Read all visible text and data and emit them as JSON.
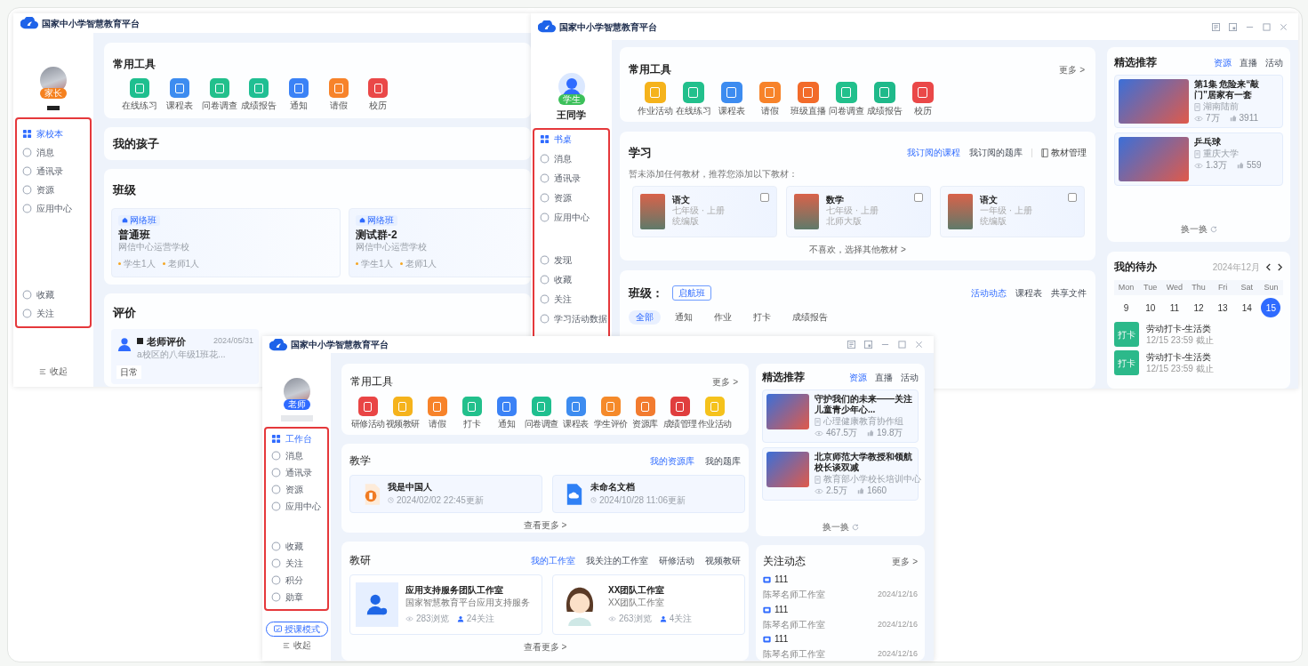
{
  "windows": [
    {
      "kind": "parent",
      "logo_text": "国家中小学智慧教育平台",
      "sidebar": {
        "badge": "家长",
        "nav": [
          {
            "label": "家校本",
            "selected": true
          },
          {
            "label": "消息",
            "selected": false
          },
          {
            "label": "通讯录",
            "selected": false
          },
          {
            "label": "资源",
            "selected": false
          },
          {
            "label": "应用中心",
            "selected": false
          }
        ],
        "nav_bottom": [
          {
            "label": "收藏",
            "selected": false
          },
          {
            "label": "关注",
            "selected": false
          }
        ],
        "collapse": "收起"
      },
      "tools": {
        "title": "常用工具",
        "items": [
          {
            "label": "在线练习",
            "color": "#1fbf8f"
          },
          {
            "label": "课程表",
            "color": "#3d8cf0"
          },
          {
            "label": "问卷调查",
            "color": "#22c08c"
          },
          {
            "label": "成绩报告",
            "color": "#20bf93"
          },
          {
            "label": "通知",
            "color": "#3b82f6"
          },
          {
            "label": "请假",
            "color": "#f7832a"
          },
          {
            "label": "校历",
            "color": "#ea4848"
          }
        ]
      },
      "children": {
        "title": "我的孩子"
      },
      "classes": {
        "title": "班级",
        "cards": [
          {
            "tag": "网络班",
            "name": "普通班",
            "school": "网信中心运营学校",
            "students": "学生1人",
            "teachers": "老师1人"
          },
          {
            "tag": "网络班",
            "name": "测试群-2",
            "school": "网信中心运营学校",
            "students": "学生1人",
            "teachers": "老师1人"
          }
        ]
      },
      "evaluation": {
        "title": "评价",
        "card": {
          "title": "老师评价",
          "desc": "a校区的八年级1班花...",
          "date": "2024/05/31",
          "tag": "日常"
        }
      }
    },
    {
      "kind": "student",
      "logo_text": "国家中小学智慧教育平台",
      "sidebar": {
        "badge": "学生",
        "user_name": "王同学",
        "nav": [
          {
            "label": "书桌",
            "selected": true
          },
          {
            "label": "消息",
            "selected": false
          },
          {
            "label": "通讯录",
            "selected": false
          },
          {
            "label": "资源",
            "selected": false
          },
          {
            "label": "应用中心",
            "selected": false
          }
        ],
        "nav_bottom": [
          {
            "label": "发现",
            "selected": false
          },
          {
            "label": "收藏",
            "selected": false
          },
          {
            "label": "关注",
            "selected": false
          },
          {
            "label": "学习活动数据",
            "selected": false
          }
        ]
      },
      "tools": {
        "title": "常用工具",
        "more": "更多 >",
        "items": [
          {
            "label": "作业活动",
            "color": "#f5b31c"
          },
          {
            "label": "在线练习",
            "color": "#22c08c"
          },
          {
            "label": "课程表",
            "color": "#3d8cf0"
          },
          {
            "label": "请假",
            "color": "#f7832a"
          },
          {
            "label": "班级直播",
            "color": "#f26b2a"
          },
          {
            "label": "问卷调查",
            "color": "#22c08c"
          },
          {
            "label": "成绩报告",
            "color": "#1fb98a"
          },
          {
            "label": "校历",
            "color": "#ea4848"
          }
        ]
      },
      "study": {
        "title": "学习",
        "tabs": [
          {
            "label": "我订阅的课程",
            "selected": true
          },
          {
            "label": "我订阅的题库",
            "selected": false
          }
        ],
        "manage": "教材管理",
        "hint": "暂未添加任何教材，推荐您添加以下教材：",
        "books": [
          {
            "title": "语文",
            "grade": "七年级 · 上册",
            "edition": "统编版",
            "checked": false
          },
          {
            "title": "数学",
            "grade": "七年级 · 上册",
            "edition": "北师大版",
            "checked": false
          },
          {
            "title": "语文",
            "grade": "一年级 · 上册",
            "edition": "统编版",
            "checked": false
          }
        ],
        "more": "不喜欢，选择其他教材 >"
      },
      "class_feed": {
        "title": "班级：",
        "class_tag": "启航班",
        "tabs": [
          {
            "label": "活动动态",
            "selected": true
          },
          {
            "label": "课程表",
            "selected": false
          },
          {
            "label": "共享文件",
            "selected": false
          }
        ],
        "filters": [
          {
            "label": "全部",
            "selected": true
          },
          {
            "label": "通知",
            "selected": false
          },
          {
            "label": "作业",
            "selected": false
          },
          {
            "label": "打卡",
            "selected": false
          },
          {
            "label": "成绩报告",
            "selected": false
          }
        ]
      },
      "featured": {
        "title": "精选推荐",
        "tabs": [
          {
            "label": "资源",
            "selected": true
          },
          {
            "label": "直播",
            "selected": false
          },
          {
            "label": "活动",
            "selected": false
          }
        ],
        "items": [
          {
            "title": "第1集 危险来“敲门”居家有一套",
            "source": "湖南陆前",
            "views": "7万",
            "likes": "3911"
          },
          {
            "title": "乒乓球",
            "source": "重庆大学",
            "views": "1.3万",
            "likes": "559"
          }
        ],
        "refresh": "换一换"
      },
      "todo": {
        "title": "我的待办",
        "month": "2024年12月",
        "weekdays": [
          "Mon",
          "Tue",
          "Wed",
          "Thu",
          "Fri",
          "Sat",
          "Sun"
        ],
        "days": [
          {
            "label": "9",
            "selected": false
          },
          {
            "label": "10",
            "selected": false
          },
          {
            "label": "11",
            "selected": false
          },
          {
            "label": "12",
            "selected": false
          },
          {
            "label": "13",
            "selected": false
          },
          {
            "label": "14",
            "selected": false
          },
          {
            "label": "15",
            "selected": true
          }
        ],
        "items": [
          {
            "tag": "打卡",
            "title": "劳动打卡-生活类",
            "deadline": "12/15 23:59 截止"
          },
          {
            "tag": "打卡",
            "title": "劳动打卡-生活类",
            "deadline": "12/15 23:59 截止"
          }
        ]
      }
    },
    {
      "kind": "teacher",
      "logo_text": "国家中小学智慧教育平台",
      "sidebar": {
        "badge": "老师",
        "nav": [
          {
            "label": "工作台",
            "selected": true
          },
          {
            "label": "消息",
            "selected": false
          },
          {
            "label": "通讯录",
            "selected": false
          },
          {
            "label": "资源",
            "selected": false
          },
          {
            "label": "应用中心",
            "selected": false
          }
        ],
        "nav_bottom": [
          {
            "label": "收藏",
            "selected": false
          },
          {
            "label": "关注",
            "selected": false
          },
          {
            "label": "积分",
            "selected": false
          },
          {
            "label": "勋章",
            "selected": false
          }
        ],
        "mode_button": "授课模式",
        "collapse": "收起"
      },
      "tools": {
        "title": "常用工具",
        "more": "更多 >",
        "items": [
          {
            "label": "研修活动",
            "color": "#e94545"
          },
          {
            "label": "视频教研",
            "color": "#f5b31c"
          },
          {
            "label": "请假",
            "color": "#f7832a"
          },
          {
            "label": "打卡",
            "color": "#22c08c"
          },
          {
            "label": "通知",
            "color": "#3b82f6"
          },
          {
            "label": "问卷调查",
            "color": "#1fbf8f"
          },
          {
            "label": "课程表",
            "color": "#3d8cf0"
          },
          {
            "label": "学生评价",
            "color": "#f58a2a"
          },
          {
            "label": "资源库",
            "color": "#f27b2f"
          },
          {
            "label": "成绩管理",
            "color": "#e03e3e"
          },
          {
            "label": "作业活动",
            "color": "#f5c21c"
          }
        ]
      },
      "teaching": {
        "title": "教学",
        "tabs": [
          {
            "label": "我的资源库",
            "selected": true
          },
          {
            "label": "我的题库",
            "selected": false
          }
        ],
        "files": [
          {
            "kind": "slides",
            "title": "我是中国人",
            "updated": "2024/02/02 22:45更新"
          },
          {
            "kind": "cloud",
            "title": "未命名文档",
            "updated": "2024/10/28 11:06更新"
          }
        ],
        "more": "查看更多 >"
      },
      "research": {
        "title": "教研",
        "tabs": [
          {
            "label": "我的工作室",
            "selected": true
          },
          {
            "label": "我关注的工作室",
            "selected": false
          },
          {
            "label": "研修活动",
            "selected": false
          },
          {
            "label": "视频教研",
            "selected": false
          }
        ],
        "studios": [
          {
            "kind": "person",
            "title": "应用支持服务团队工作室",
            "desc": "国家智慧教育平台应用支持服务",
            "views": "283浏览",
            "follows": "24关注"
          },
          {
            "kind": "cartoon",
            "title": "XX团队工作室",
            "desc": "XX团队工作室",
            "views": "263浏览",
            "follows": "4关注"
          }
        ],
        "more": "查看更多 >"
      },
      "featured": {
        "title": "精选推荐",
        "tabs": [
          {
            "label": "资源",
            "selected": true
          },
          {
            "label": "直播",
            "selected": false
          },
          {
            "label": "活动",
            "selected": false
          }
        ],
        "items": [
          {
            "title": "守护我们的未来——关注儿童青少年心...",
            "source": "心理健康教育协作组",
            "views": "467.5万",
            "likes": "19.8万"
          },
          {
            "title": "北京师范大学教授和领航校长谈双减",
            "source": "教育部小学校长培训中心",
            "views": "2.5万",
            "likes": "1660"
          }
        ],
        "refresh": "换一换"
      },
      "follow_feed": {
        "title": "关注动态",
        "more": "更多 >",
        "items": [
          {
            "title": "111",
            "studio": "陈琴名师工作室",
            "date": "2024/12/16"
          },
          {
            "title": "111",
            "studio": "陈琴名师工作室",
            "date": "2024/12/16"
          },
          {
            "title": "111",
            "studio": "陈琴名师工作室",
            "date": "2024/12/16"
          }
        ]
      }
    }
  ]
}
